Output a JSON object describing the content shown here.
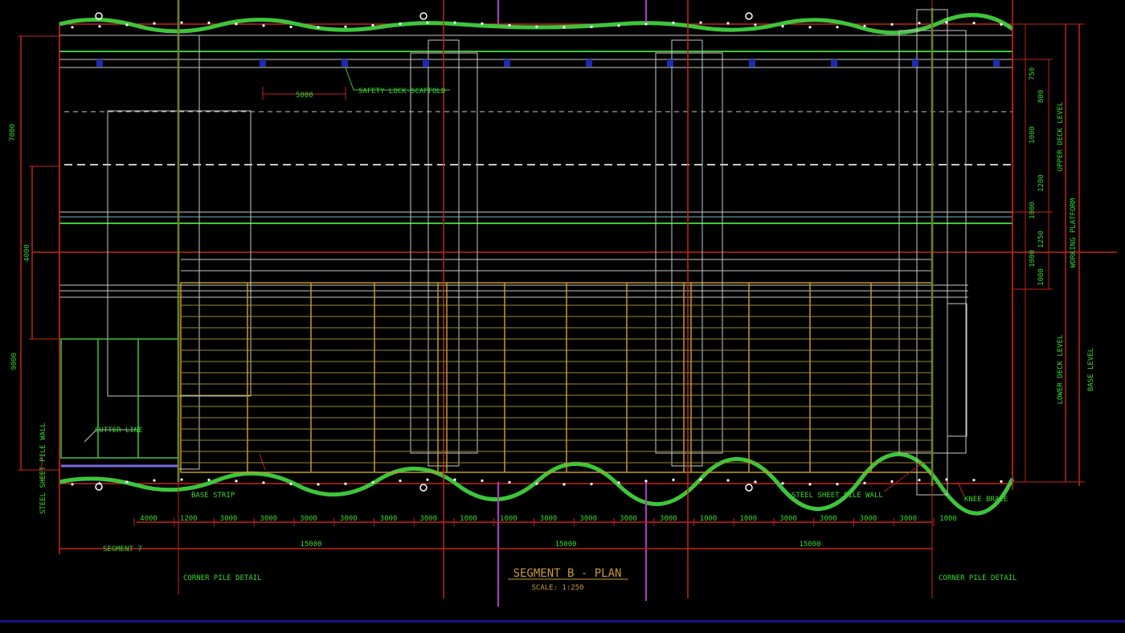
{
  "drawing": {
    "title": "SEGMENT B - PLAN",
    "scale": "SCALE: 1:250",
    "callouts": {
      "scaffold": "SAFETY LOCK-SCAFFOLD",
      "scaffold_dim": "5000",
      "cutter": "CUTTER LINE",
      "base_strip": "BASE STRIP",
      "sheet_pile_left": "STEEL SHEET PILE WALL",
      "sheet_pile_right": "STEEL SHEET PILE WALL",
      "end_note": "KNEE BRACE",
      "segment": "SEGMENT 7"
    },
    "dims": {
      "bottom_small": [
        "4000",
        "1200",
        "3000",
        "3000",
        "3000",
        "3000",
        "3000",
        "3000",
        "1000",
        "1000",
        "3000",
        "3000",
        "3000",
        "3000",
        "1000",
        "1000",
        "3000",
        "3000",
        "3000",
        "3000",
        "1000"
      ],
      "bottom_large": [
        "15000",
        "15000",
        "15000"
      ],
      "left": [
        "7000",
        "4000",
        "9000"
      ],
      "right_small": [
        "750",
        "800",
        "1000",
        "1200",
        "1000",
        "1250",
        "1000",
        "1000"
      ],
      "right_large": [
        "UPPER DECK LEVEL",
        "WORKING PLATFORM",
        "LOWER DECK LEVEL",
        "BASE LEVEL"
      ]
    },
    "legend_left": "CORNER PILE DETAIL",
    "legend_right": "CORNER PILE DETAIL",
    "palette": {
      "border": "#3ec63a",
      "axis": "#c2241b",
      "gridline": "#c09a2e",
      "light": "#c8c8c8",
      "magenta": "#b23acb",
      "blue": "#1f2ab0"
    }
  }
}
